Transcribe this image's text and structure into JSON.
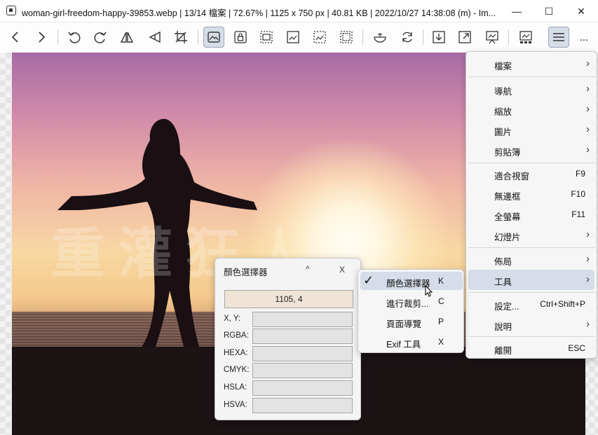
{
  "window": {
    "title": "woman-girl-freedom-happy-39853.webp  |  13/14 檔案  |  72.67%  |  1125 x 750 px  |  40.81 KB  |  2022/10/27 14:38:08 (m)  -  Im...",
    "min_glyph": "—",
    "max_glyph": "☐",
    "close_glyph": "✕"
  },
  "toolbar": {
    "more_label": "...",
    "buttons": [
      "previous-image",
      "next-image",
      "rotate-left",
      "rotate-right",
      "flip-horizontal",
      "flip-vertical",
      "crop",
      "color-picker",
      "lock",
      "frameless",
      "fit-window",
      "fullscreen",
      "checkerboard",
      "delete",
      "refresh",
      "open-location",
      "maximize",
      "slideshow",
      "gallery",
      "main-menu"
    ]
  },
  "image": {
    "watermark": "重灌狂人"
  },
  "color_picker": {
    "title": "顏色選擇器",
    "collapse": "^",
    "close": "X",
    "coordinate": "1105, 4",
    "rows": [
      {
        "label": "X, Y:"
      },
      {
        "label": "RGBA:"
      },
      {
        "label": "HEXA:"
      },
      {
        "label": "CMYK:"
      },
      {
        "label": "HSLA:"
      },
      {
        "label": "HSVA:"
      }
    ]
  },
  "main_menu": {
    "items": [
      {
        "label": "檔案",
        "submenu": true
      },
      {
        "label": "導航",
        "submenu": true
      },
      {
        "label": "縮放",
        "submenu": true
      },
      {
        "label": "圖片",
        "submenu": true
      },
      {
        "label": "剪貼簿",
        "submenu": true
      },
      {
        "label": "適合視窗",
        "shortcut": "F9"
      },
      {
        "label": "無邊框",
        "shortcut": "F10"
      },
      {
        "label": "全螢幕",
        "shortcut": "F11"
      },
      {
        "label": "幻燈片",
        "submenu": true
      },
      {
        "label": "佈局",
        "submenu": true
      },
      {
        "label": "工具",
        "submenu": true,
        "highlighted": true
      },
      {
        "label": "設定...",
        "shortcut": "Ctrl+Shift+P"
      },
      {
        "label": "說明",
        "submenu": true
      },
      {
        "label": "離開",
        "shortcut": "ESC"
      }
    ],
    "arrow_glyph": "›"
  },
  "tools_submenu": {
    "items": [
      {
        "label": "顏色選擇器",
        "shortcut": "K",
        "checked": true,
        "highlighted": true
      },
      {
        "label": "進行裁剪...",
        "shortcut": "C"
      },
      {
        "label": "頁面導覽",
        "shortcut": "P"
      },
      {
        "label": "Exif 工具",
        "shortcut": "X"
      }
    ],
    "check_glyph": "✓"
  }
}
